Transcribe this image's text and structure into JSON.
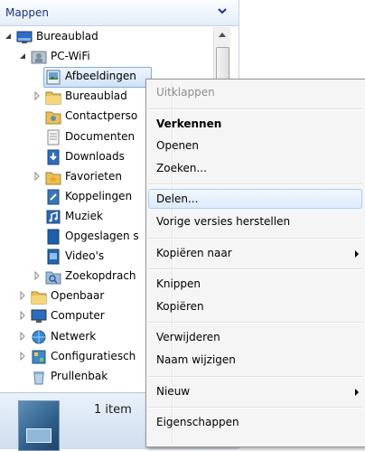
{
  "pane": {
    "title": "Mappen",
    "tree": [
      {
        "label": "Bureaublad",
        "icon": "desktop-icon",
        "expander": "expanded"
      },
      {
        "label": "PC-WiFi",
        "icon": "user-folder-icon",
        "expander": "expanded"
      },
      {
        "label": "Afbeeldingen",
        "icon": "pictures-folder-icon",
        "expander": "none",
        "selected": true
      },
      {
        "label": "Bureaublad",
        "icon": "folder-icon",
        "expander": "collapsed"
      },
      {
        "label": "Contactperso",
        "icon": "contacts-folder-icon",
        "expander": "none"
      },
      {
        "label": "Documenten",
        "icon": "documents-folder-icon",
        "expander": "none"
      },
      {
        "label": "Downloads",
        "icon": "downloads-folder-icon",
        "expander": "none"
      },
      {
        "label": "Favorieten",
        "icon": "favorites-folder-icon",
        "expander": "collapsed"
      },
      {
        "label": "Koppelingen",
        "icon": "links-folder-icon",
        "expander": "none"
      },
      {
        "label": "Muziek",
        "icon": "music-folder-icon",
        "expander": "none"
      },
      {
        "label": "Opgeslagen s",
        "icon": "saved-games-folder-icon",
        "expander": "none"
      },
      {
        "label": "Video's",
        "icon": "videos-folder-icon",
        "expander": "none"
      },
      {
        "label": "Zoekopdrach",
        "icon": "searches-folder-icon",
        "expander": "collapsed"
      },
      {
        "label": "Openbaar",
        "icon": "folder-icon",
        "expander": "collapsed"
      },
      {
        "label": "Computer",
        "icon": "computer-icon",
        "expander": "collapsed"
      },
      {
        "label": "Netwerk",
        "icon": "network-icon",
        "expander": "collapsed"
      },
      {
        "label": "Configuratiesch",
        "icon": "control-panel-icon",
        "expander": "collapsed"
      },
      {
        "label": "Prullenbak",
        "icon": "recycle-bin-icon",
        "expander": "none"
      }
    ]
  },
  "details": {
    "count": "1 item"
  },
  "context_menu": {
    "items": [
      {
        "label": "Uitklappen",
        "state": "disabled"
      },
      {
        "type": "separator"
      },
      {
        "label": "Verkennen",
        "state": "bold"
      },
      {
        "label": "Openen"
      },
      {
        "label": "Zoeken..."
      },
      {
        "type": "separator"
      },
      {
        "label": "Delen...",
        "state": "hover"
      },
      {
        "label": "Vorige versies herstellen"
      },
      {
        "type": "separator"
      },
      {
        "label": "Kopiëren naar",
        "submenu": true
      },
      {
        "type": "separator"
      },
      {
        "label": "Knippen"
      },
      {
        "label": "Kopiëren"
      },
      {
        "type": "separator"
      },
      {
        "label": "Verwijderen"
      },
      {
        "label": "Naam wijzigen"
      },
      {
        "type": "separator"
      },
      {
        "label": "Nieuw",
        "submenu": true
      },
      {
        "type": "separator"
      },
      {
        "label": "Eigenschappen"
      }
    ]
  },
  "colors": {
    "header_text": "#1e3287",
    "selection_border": "#84acdd",
    "menu_hover_border": "#a8d0f5",
    "disabled_text": "#8d8d8d"
  }
}
